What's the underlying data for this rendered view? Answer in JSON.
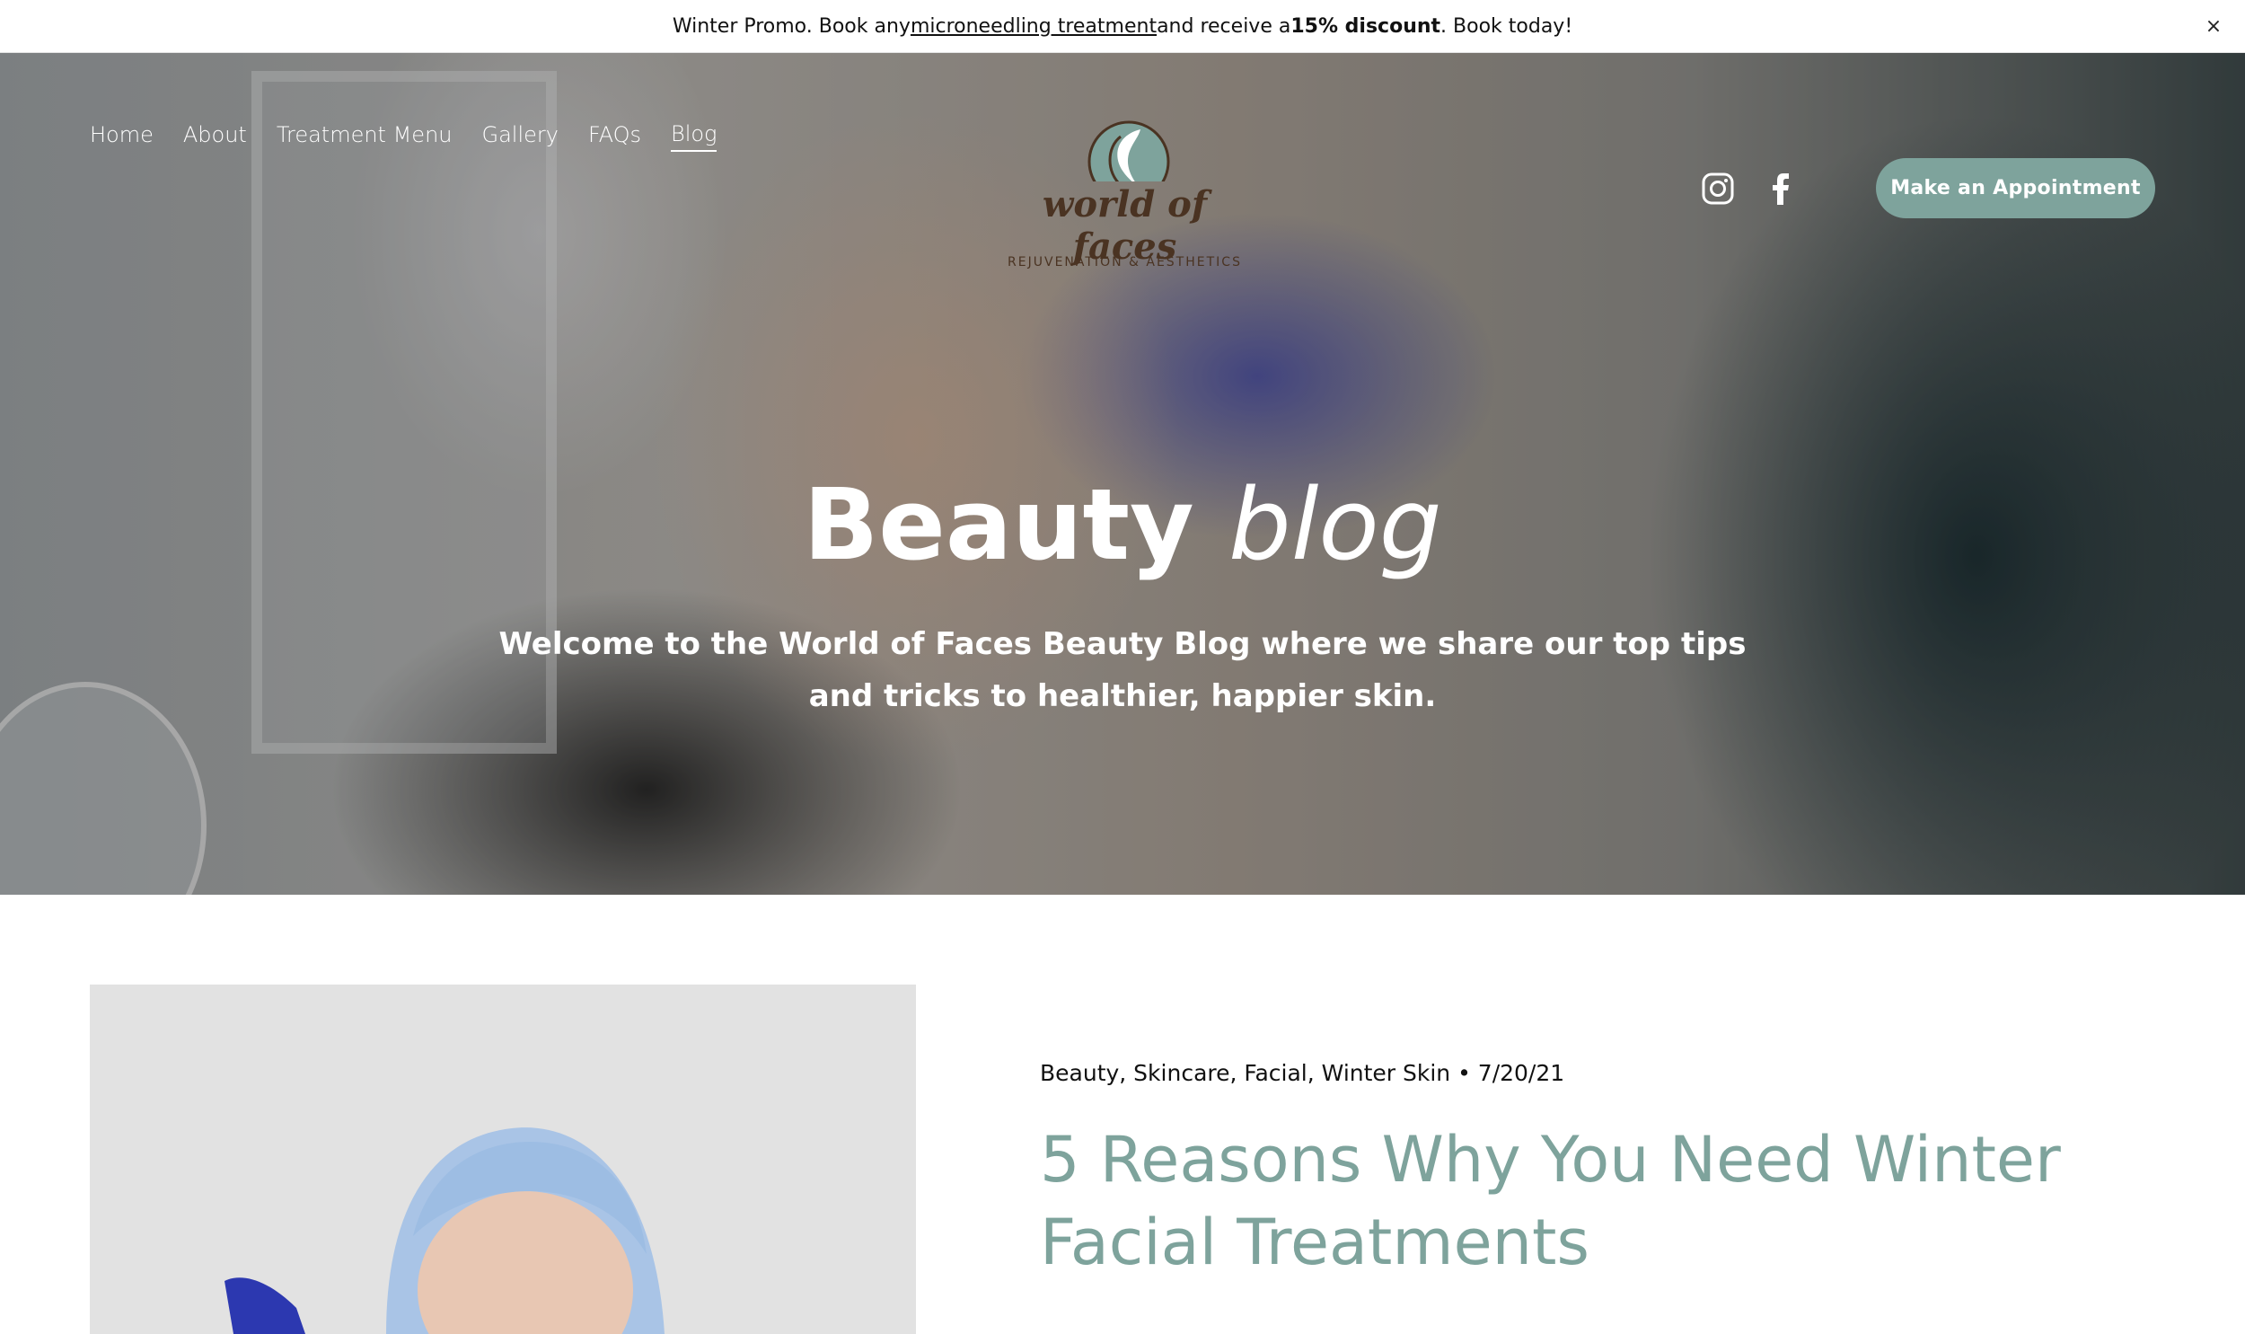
{
  "promo": {
    "text_before": "Winter Promo. Book any ",
    "link_text": "microneedling treatment",
    "text_middle": " and receive a ",
    "bold_text": "15% discount",
    "text_after": ". Book today!",
    "close_icon": "×"
  },
  "nav": {
    "items": [
      {
        "label": "Home"
      },
      {
        "label": "About"
      },
      {
        "label": "Treatment Menu"
      },
      {
        "label": "Gallery"
      },
      {
        "label": "FAQs"
      },
      {
        "label": "Blog"
      }
    ],
    "active": "Blog"
  },
  "logo": {
    "script": "world of faces",
    "subtitle": "REJUVENATION & AESTHETICS"
  },
  "social": {
    "instagram_icon": "instagram-icon",
    "facebook_icon": "facebook-icon"
  },
  "cta": {
    "label": "Make an Appointment"
  },
  "hero": {
    "title_bold": "Beauty",
    "title_italic": "blog",
    "subtitle": "Welcome to the World of Faces Beauty Blog where we share our top tips and tricks to healthier, happier skin."
  },
  "post": {
    "meta": "Beauty, Skincare, Facial, Winter Skin • 7/20/21",
    "title": "5 Reasons Why You Need Winter Facial Treatments"
  },
  "colors": {
    "accent": "#7ea39c",
    "logo_brown": "#4a3322",
    "glove_blue": "#2f3bb3"
  }
}
